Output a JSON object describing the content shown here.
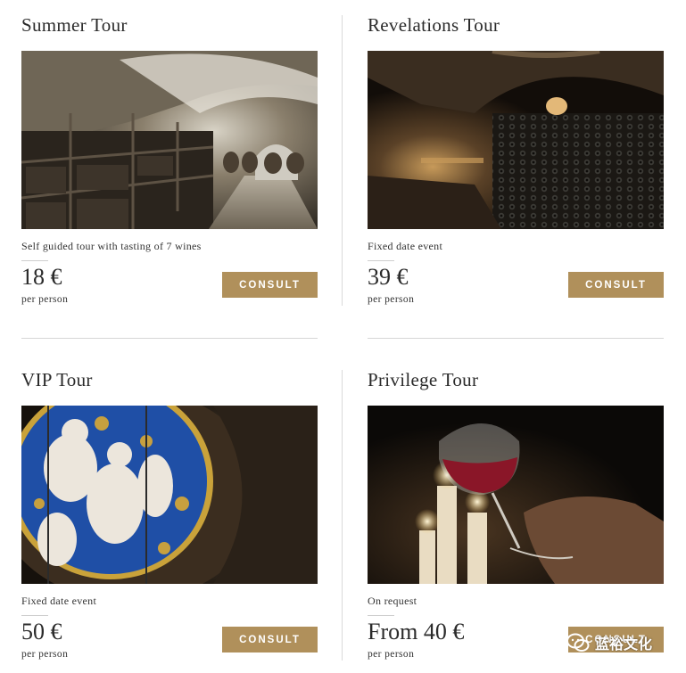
{
  "tours": [
    {
      "title": "Summer Tour",
      "description": "Self guided tour with tasting of 7 wines",
      "price": "18 €",
      "unit": "per person",
      "button": "CONSULT",
      "image": "wine-cellar-corridor"
    },
    {
      "title": "Revelations Tour",
      "description": "Fixed date event",
      "price": "39 €",
      "unit": "per person",
      "button": "CONSULT",
      "image": "dark-bottle-cellar"
    },
    {
      "title": "VIP Tour",
      "description": "Fixed date event",
      "price": "50 €",
      "unit": "per person",
      "button": "CONSULT",
      "image": "stained-glass-window"
    },
    {
      "title": "Privilege Tour",
      "description": "On request",
      "price": "From 40 €",
      "unit": "per person",
      "button": "CONSULT",
      "image": "red-wine-glass-candles"
    }
  ],
  "watermark": {
    "text": "蓝裕文化",
    "icon": "wechat-icon"
  },
  "colors": {
    "button": "#b0905b",
    "text": "#2b2b2b",
    "divider": "#d6d6d6"
  }
}
